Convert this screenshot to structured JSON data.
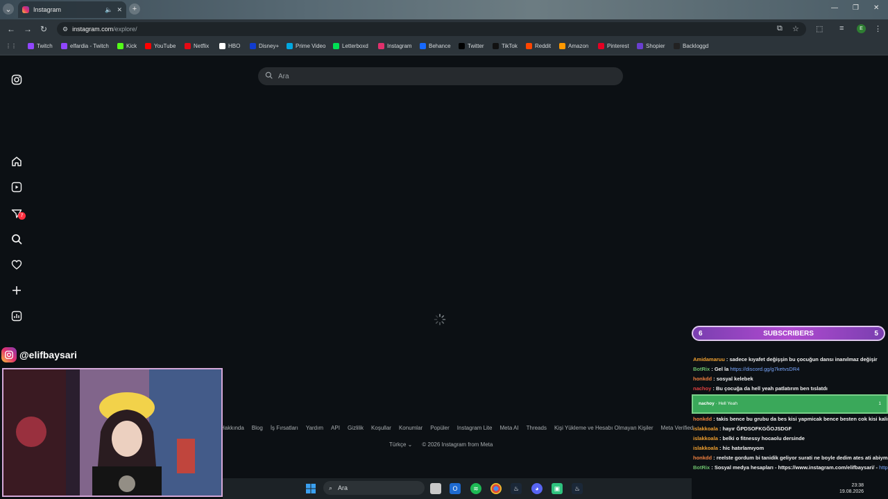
{
  "browser": {
    "tab_title": "Instagram",
    "url_host": "instagram.com",
    "url_path": "/explore/",
    "profile_initial": "E",
    "bookmarks": [
      {
        "label": "Twitch",
        "color": "#9146ff"
      },
      {
        "label": "elfardia - Twitch",
        "color": "#9146ff"
      },
      {
        "label": "Kick",
        "color": "#53fc18"
      },
      {
        "label": "YouTube",
        "color": "#ff0000"
      },
      {
        "label": "Netflix",
        "color": "#e50914"
      },
      {
        "label": "HBO",
        "color": "#ffffff"
      },
      {
        "label": "Disney+",
        "color": "#113ccf"
      },
      {
        "label": "Prime Video",
        "color": "#00a8e1"
      },
      {
        "label": "Letterboxd",
        "color": "#00e054"
      },
      {
        "label": "Instagram",
        "color": "#e1306c"
      },
      {
        "label": "Behance",
        "color": "#1769ff"
      },
      {
        "label": "Twitter",
        "color": "#000000"
      },
      {
        "label": "TikTok",
        "color": "#111111"
      },
      {
        "label": "Reddit",
        "color": "#ff4500"
      },
      {
        "label": "Amazon",
        "color": "#ff9900"
      },
      {
        "label": "Pinterest",
        "color": "#e60023"
      },
      {
        "label": "Shopier",
        "color": "#6a3fd0"
      },
      {
        "label": "Backloggd",
        "color": "#222222"
      }
    ]
  },
  "instagram": {
    "search_placeholder": "Ara",
    "messages_badge": "7",
    "sidebar_icons": [
      "instagram-logo-icon",
      "home-icon",
      "reels-icon",
      "messages-icon",
      "search-icon",
      "heart-icon",
      "plus-icon",
      "insights-icon"
    ],
    "footer_links": [
      "Hakkında",
      "Blog",
      "İş Fırsatları",
      "Yardım",
      "API",
      "Gizlilik",
      "Koşullar",
      "Konumlar",
      "Popüler",
      "Instagram Lite",
      "Meta AI",
      "Threads",
      "Kişi Yükleme ve Hesabı Olmayan Kişiler",
      "Meta Verified"
    ],
    "language": "Türkçe",
    "copyright": "© 2026 Instagram from Meta"
  },
  "stream": {
    "handle": "@elifbaysari",
    "subs_left": "6",
    "subs_title": "SUBSCRIBERS",
    "subs_right": "5",
    "alert_user": "nachoy",
    "alert_text": "Hell Yeah",
    "alert_count": "1",
    "chat": [
      {
        "user": "Amidamaruu",
        "cls": "u1",
        "msg": "sadece kıyafet değişşin bu çocuğun dansı inanılmaz değişir"
      },
      {
        "user": "BotRix",
        "cls": "u2",
        "msg": "Gel la ",
        "link": "https://discord.gg/g7ketvsDR4"
      },
      {
        "user": "honkdd",
        "cls": "u3",
        "msg": "sosyal kelebek"
      },
      {
        "user": "nachoy",
        "cls": "u4",
        "msg": "Bu çocuğa da hell yeah patlatırım ben tıslatdı"
      }
    ],
    "chat2": [
      {
        "user": "honkdd",
        "cls": "u3",
        "msg": "takis bence bu grubu da bes kisi yapmicak bence besten cok kisi kalir elde"
      },
      {
        "user": "islakkoala",
        "cls": "u1",
        "msg": "hayır ĞPDSOFKGĞOJSDGF"
      },
      {
        "user": "islakkoala",
        "cls": "u1",
        "msg": "belki o fitnessy hocaolu dersinde"
      },
      {
        "user": "islakkoala",
        "cls": "u1",
        "msg": "hic hatırlamıyom"
      },
      {
        "user": "honkdd",
        "cls": "u3",
        "msg": "reelste gordum bi tanidik geliyor surati ne boyle dedim ates ati abiymis valla"
      },
      {
        "user": "BotRix",
        "cls": "u2",
        "msg": "Sosyal medya hesapları - https://www.instagram.com/elifbaysari/ - ",
        "link": "https://twitter.com/elfardia"
      }
    ]
  },
  "taskbar": {
    "search_placeholder": "Ara",
    "time": "23:38",
    "date": "19.08.2026"
  }
}
